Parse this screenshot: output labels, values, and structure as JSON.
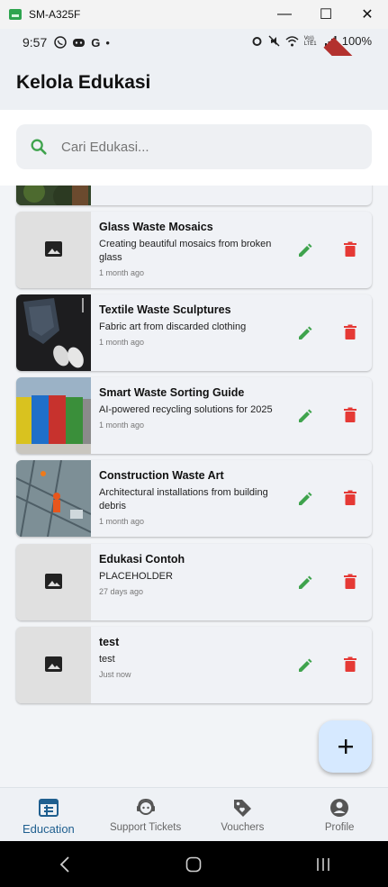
{
  "window": {
    "title": "SM-A325F",
    "minimize": "—",
    "maximize": "☐",
    "close": "✕"
  },
  "status": {
    "time": "9:57",
    "battery": "100%",
    "dot": "•",
    "app_g": "G",
    "signal_label": "Vo)) LTE1",
    "debug_banner": "DEBUG"
  },
  "app_bar": {
    "title": "Kelola Edukasi"
  },
  "search": {
    "placeholder": "Cari Edukasi..."
  },
  "items": [
    {
      "title": "Glass Waste Mosaics",
      "desc": "Creating beautiful mosaics from broken glass",
      "time": "1 month ago",
      "image": "placeholder"
    },
    {
      "title": "Textile Waste Sculptures",
      "desc": "Fabric art from discarded clothing",
      "time": "1 month ago",
      "image": "clothes-photo"
    },
    {
      "title": "Smart Waste Sorting Guide",
      "desc": "AI-powered recycling solutions for 2025",
      "time": "1 month ago",
      "image": "bins-photo"
    },
    {
      "title": "Construction Waste Art",
      "desc": "Architectural installations from building debris",
      "time": "1 month ago",
      "image": "construction-photo"
    },
    {
      "title": "Edukasi Contoh",
      "desc": "PLACEHOLDER",
      "time": "27 days ago",
      "image": "placeholder"
    },
    {
      "title": "test",
      "desc": "test",
      "time": "Just now",
      "image": "placeholder"
    }
  ],
  "nav": [
    {
      "label": "Education",
      "icon": "education-icon",
      "active": true
    },
    {
      "label": "Support Tickets",
      "icon": "support-icon",
      "active": false
    },
    {
      "label": "Vouchers",
      "icon": "voucher-icon",
      "active": false
    },
    {
      "label": "Profile",
      "icon": "profile-icon",
      "active": false
    }
  ],
  "colors": {
    "edit": "#3fa34d",
    "delete": "#e53935",
    "accent": "#1f5f8f",
    "fab": "#d6e9ff"
  }
}
